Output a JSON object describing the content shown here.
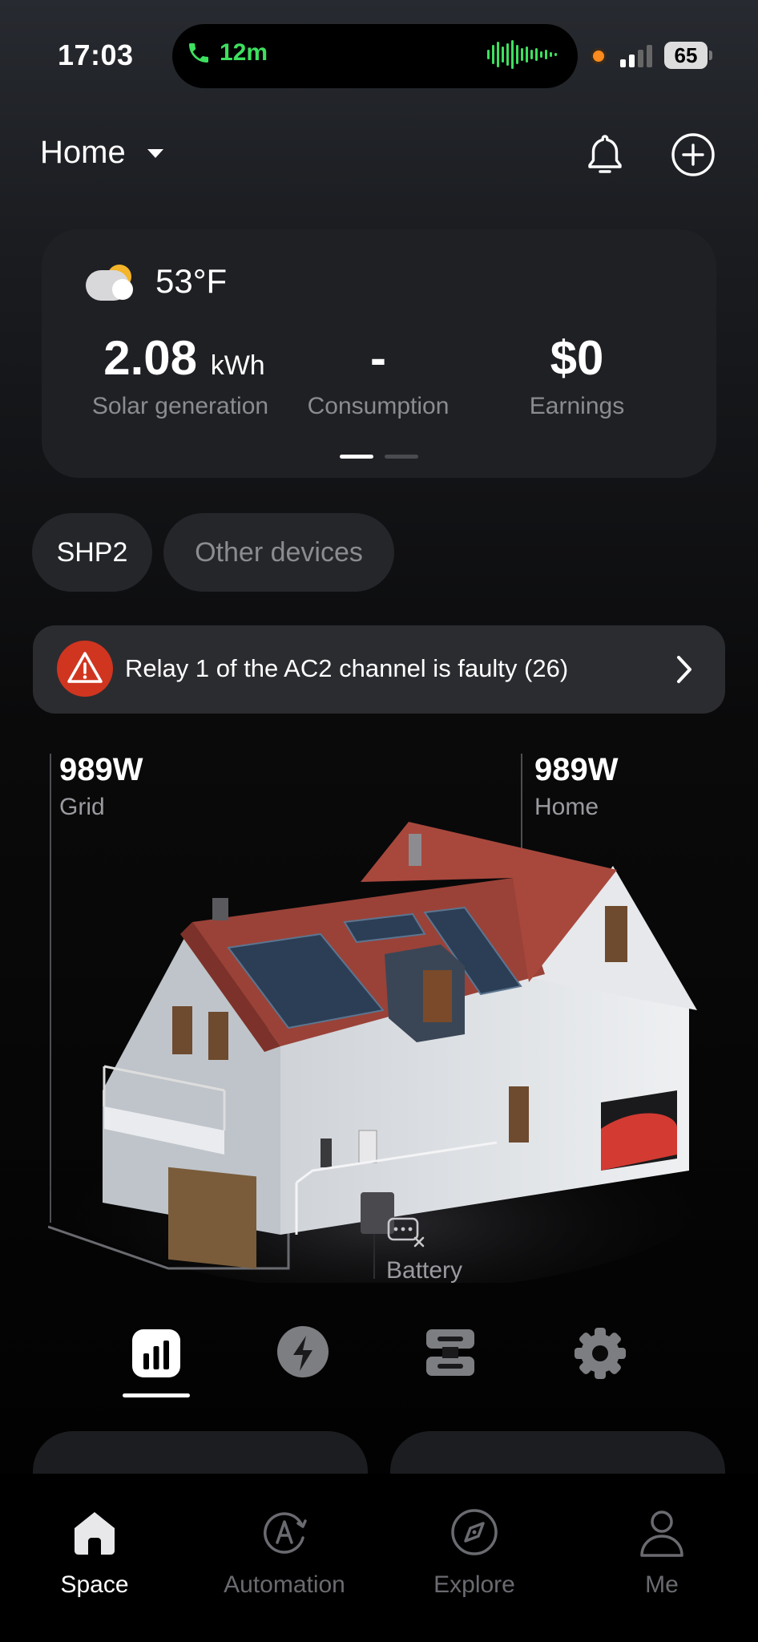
{
  "status_bar": {
    "time": "17:03",
    "call_duration": "12m",
    "battery_level": "65"
  },
  "header": {
    "location": "Home"
  },
  "summary": {
    "temperature": "53°F",
    "solar_value": "2.08",
    "solar_unit": "kWh",
    "solar_label": "Solar generation",
    "consumption_value": "-",
    "consumption_label": "Consumption",
    "earnings_value": "$0",
    "earnings_label": "Earnings",
    "page_index": 1,
    "page_count": 2
  },
  "chips": {
    "active": "SHP2",
    "other": "Other devices"
  },
  "alert": {
    "text": "Relay 1 of the AC2 channel is faulty (26)",
    "color": "#d0351f"
  },
  "energy_flow": {
    "grid_value": "989W",
    "grid_label": "Grid",
    "home_value": "989W",
    "home_label": "Home",
    "battery_label": "Battery"
  },
  "tabs": {
    "items": [
      "chart-icon",
      "bolt-icon",
      "devices-icon",
      "gear-icon"
    ],
    "selected": "chart-icon"
  },
  "bottom_nav": {
    "items": [
      {
        "label": "Space",
        "icon": "house-icon",
        "active": true
      },
      {
        "label": "Automation",
        "icon": "automation-icon",
        "active": false
      },
      {
        "label": "Explore",
        "icon": "compass-icon",
        "active": false
      },
      {
        "label": "Me",
        "icon": "person-icon",
        "active": false
      }
    ]
  }
}
